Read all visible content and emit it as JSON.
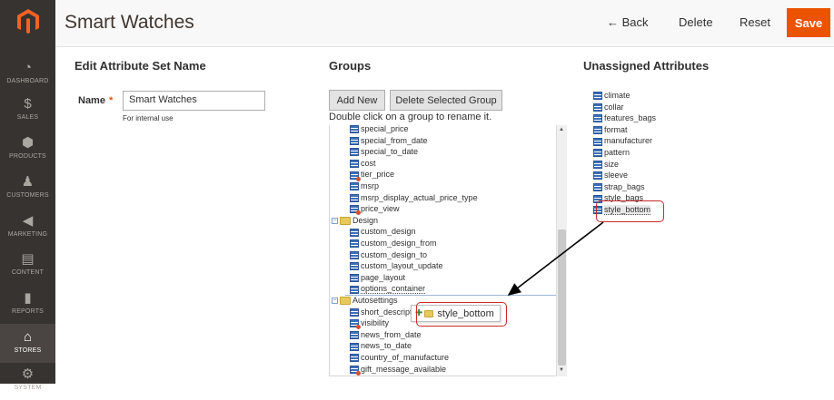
{
  "sidebar": {
    "items": [
      {
        "label": "DASHBOARD",
        "icon": "dashboard-icon"
      },
      {
        "label": "SALES",
        "icon": "dollar-icon"
      },
      {
        "label": "PRODUCTS",
        "icon": "cube-icon"
      },
      {
        "label": "CUSTOMERS",
        "icon": "person-icon"
      },
      {
        "label": "MARKETING",
        "icon": "megaphone-icon"
      },
      {
        "label": "CONTENT",
        "icon": "layout-icon"
      },
      {
        "label": "REPORTS",
        "icon": "bar-chart-icon"
      },
      {
        "label": "STORES",
        "icon": "store-icon"
      },
      {
        "label": "SYSTEM",
        "icon": "gear-icon"
      }
    ]
  },
  "header": {
    "title": "Smart Watches",
    "back": "← Back",
    "delete": "Delete",
    "reset": "Reset",
    "save": "Save"
  },
  "left": {
    "title": "Edit Attribute Set Name",
    "name_label": "Name",
    "required_mark": "*",
    "name_value": "Smart Watches",
    "hint": "For internal use"
  },
  "groups": {
    "title": "Groups",
    "add_new": "Add New",
    "delete_group": "Delete Selected Group",
    "hint": "Double click on a group to rename it.",
    "tree": [
      {
        "label": "special_price",
        "kind": "attr",
        "locked": false
      },
      {
        "label": "special_from_date",
        "kind": "attr",
        "locked": false
      },
      {
        "label": "special_to_date",
        "kind": "attr",
        "locked": false
      },
      {
        "label": "cost",
        "kind": "attr",
        "locked": false
      },
      {
        "label": "tier_price",
        "kind": "attr",
        "locked": true
      },
      {
        "label": "msrp",
        "kind": "attr",
        "locked": false
      },
      {
        "label": "msrp_display_actual_price_type",
        "kind": "attr",
        "locked": false
      },
      {
        "label": "price_view",
        "kind": "attr",
        "locked": true
      },
      {
        "label": "Design",
        "kind": "group"
      },
      {
        "label": "custom_design",
        "kind": "attr",
        "locked": false
      },
      {
        "label": "custom_design_from",
        "kind": "attr",
        "locked": false
      },
      {
        "label": "custom_design_to",
        "kind": "attr",
        "locked": false
      },
      {
        "label": "custom_layout_update",
        "kind": "attr",
        "locked": false
      },
      {
        "label": "page_layout",
        "kind": "attr",
        "locked": false
      },
      {
        "label": "options_container",
        "kind": "attr",
        "locked": false
      },
      {
        "label": "Autosettings",
        "kind": "group"
      },
      {
        "label": "short_descript",
        "kind": "attr",
        "locked": false
      },
      {
        "label": "visibility",
        "kind": "attr",
        "locked": true
      },
      {
        "label": "news_from_date",
        "kind": "attr",
        "locked": false
      },
      {
        "label": "news_to_date",
        "kind": "attr",
        "locked": false
      },
      {
        "label": "country_of_manufacture",
        "kind": "attr",
        "locked": false
      },
      {
        "label": "gift_message_available",
        "kind": "attr",
        "locked": true
      }
    ],
    "drag_label": "style_bottom"
  },
  "unassigned": {
    "title": "Unassigned Attributes",
    "items": [
      "climate",
      "collar",
      "features_bags",
      "format",
      "manufacturer",
      "pattern",
      "size",
      "sleeve",
      "strap_bags",
      "style_bags",
      "style_bottom"
    ],
    "selected": "style_bottom"
  },
  "colors": {
    "accent": "#eb5202",
    "sidebar": "#373330",
    "highlight": "#cc2a2a"
  }
}
